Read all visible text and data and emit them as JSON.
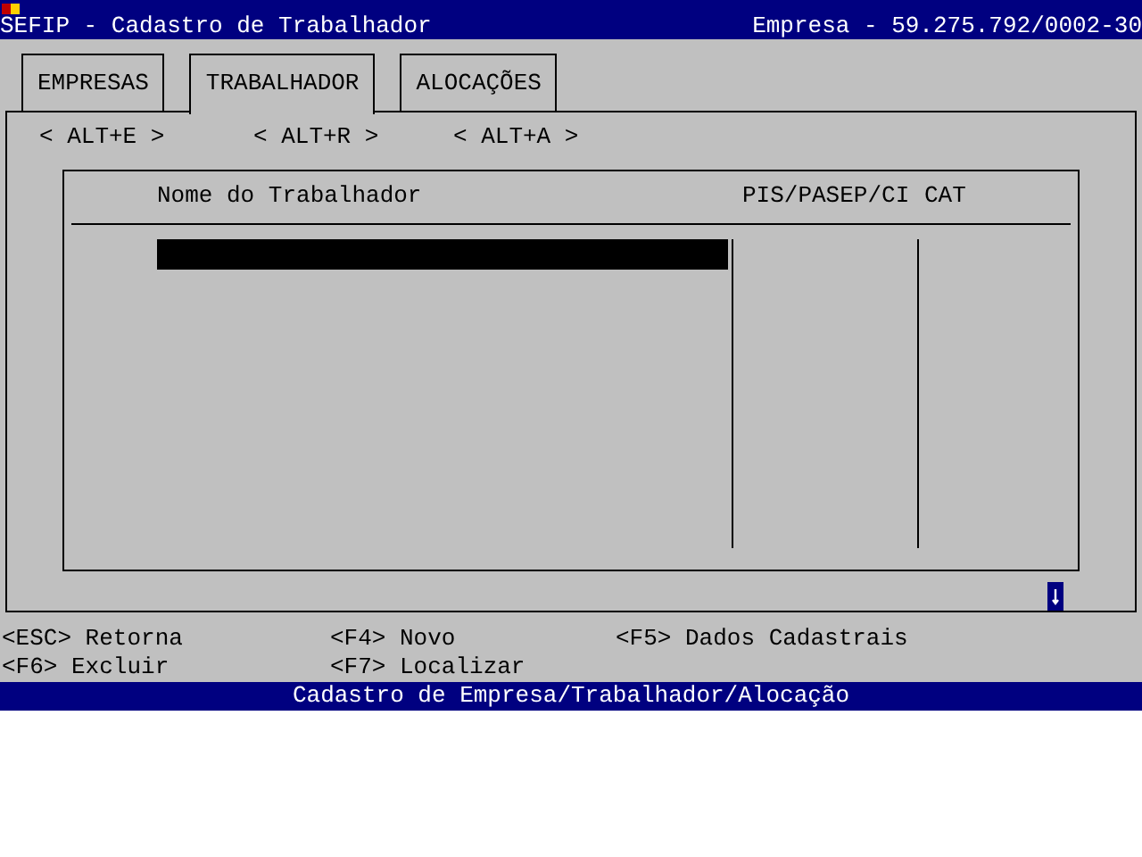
{
  "window": {
    "title": "SEFIP - Cadastro de Trabalhador",
    "company": "Empresa - 59.275.792/0002-30"
  },
  "tabs": [
    {
      "label": "EMPRESAS",
      "selected": false
    },
    {
      "label": "TRABALHADOR",
      "selected": true
    },
    {
      "label": "ALOCAÇÕES",
      "selected": false
    }
  ],
  "shortcuts": [
    "< ALT+E >",
    "< ALT+R >",
    "< ALT+A >"
  ],
  "table": {
    "columns": [
      "Nome do Trabalhador",
      "PIS/PASEP/CI",
      "CAT"
    ]
  },
  "key_hints": [
    "<ESC> Retorna",
    "<F4> Novo",
    "<F5> Dados Cadastrais",
    "<F6> Excluir",
    "<F7> Localizar"
  ],
  "status_bar": "Cadastro de Empresa/Trabalhador/Alocação"
}
